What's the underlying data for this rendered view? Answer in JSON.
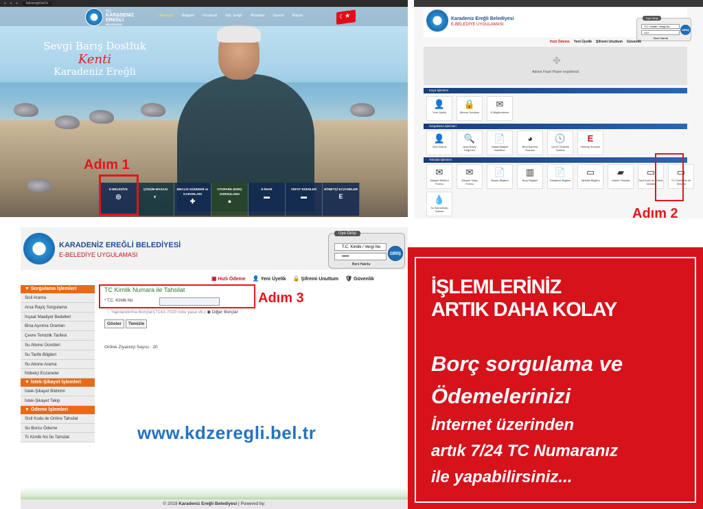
{
  "panel1": {
    "browser_url": "kdzeregli.bel.tr",
    "logo": {
      "line1": "T.C.",
      "line2": "KARADENİZ",
      "line3": "EREĞLİ",
      "line4": "BELEDİYESİ"
    },
    "menu": [
      "Anasayfa",
      "Belgeler",
      "Kurumsal",
      "Kdz. Ereğli",
      "Hizmetler",
      "Güncel",
      "İletişim"
    ],
    "slogan": {
      "line1": "Sevgi Barış Dostluk",
      "line2": "Kenti",
      "line3": "Karadeniz Ereğli"
    },
    "tiles": [
      {
        "label": "E-BELEDİYE",
        "icon": "◎"
      },
      {
        "label": "ÇÖZÜM MASASI",
        "icon": "◐"
      },
      {
        "label": "MECLİS GÜNDEMİ ve KARARLARI",
        "icon": "✚"
      },
      {
        "label": "OTOPARK BORÇ SORGULAMA",
        "icon": "●"
      },
      {
        "label": "E-İMAR",
        "icon": "▬"
      },
      {
        "label": "VEFAT EDENLER",
        "icon": "▬"
      },
      {
        "label": "NÖBETÇİ ECZANELER",
        "icon": "E"
      }
    ],
    "step_label": "Adım 1"
  },
  "panel2": {
    "org_name": "Karadeniz Ereğli Belediyesi",
    "app_name": "E-BELEDİYE UYGULAMASI",
    "login": {
      "tab": "Üye Girişi",
      "id_placeholder": "T.C. Kimlik / Vergi No",
      "password": "•••••",
      "remember": "Beni Hatırla",
      "submit": "GİRİŞ"
    },
    "links": [
      "Hızlı Ödeme",
      "Yeni Üyelik",
      "Şifremi Unuttum",
      "Güvenlik"
    ],
    "flash_text": "Adobe Flash Player engellendi",
    "sections": [
      {
        "title": "Kayıt İşlemleri",
        "items": [
          "Yeni Üyelik",
          "Şifremi Unuttum",
          "E-Bilgilendirme"
        ]
      },
      {
        "title": "Sorgulama İşlemleri",
        "items": [
          "Sicil Arama",
          "Arsa Rayiç Değerleri",
          "İnşaat Maliyet Bedelleri",
          "Bina Aşınma Oranları",
          "Çevre Temizlik Tarifesi",
          "Nöbetçi Eczane"
        ]
      },
      {
        "title": "Tahsilat İşlemleri",
        "items": [
          "Şikayet Bildirim Formu",
          "Şikayet Takip Formu",
          "Beyan Bilgileri",
          "Borç Bilgileri",
          "Tahakkuk Bilgileri",
          "Tahsilat Bilgileri",
          "Online Tahsilat",
          "Sicil Kodu ile Online Tahsilat",
          "TC Kimlik No ile Tahsilat",
          "Su Bornamatu Ödeme"
        ]
      }
    ],
    "step_label": "Adım 2"
  },
  "panel3": {
    "org_name": "KARADENİZ EREĞLİ BELEDİYESİ",
    "app_name": "E-BELEDİYE UYGULAMASI",
    "login": {
      "tab": "Üye Girişi",
      "id_placeholder": "T.C. Kimlik / Vergi No",
      "password": "•••••",
      "remember": "Beni Hatırla",
      "submit": "GİRİŞ"
    },
    "links": [
      "Hızlı Ödeme",
      "Yeni Üyelik",
      "Şifremi Unuttum",
      "Güvenlik"
    ],
    "sidebar": [
      {
        "group": "Sorgulama İşlemleri",
        "items": [
          "Sicil Arama",
          "Arsa Rayiç Sorgulama",
          "İnşaat Maaliyet Bedelleri",
          "Bina Aşınma Oranları",
          "Çevre Temizlik Tarifesi",
          "Su Abone Ücretleri",
          "Su Tarife Bilgileri",
          "Su Abone Arama",
          "Nöbetçi Eczaneler"
        ]
      },
      {
        "group": "İstek-Şikayet İşlemleri",
        "items": [
          "İstek-Şikayet Bildirimi",
          "İstek-Şikayet Takip"
        ]
      },
      {
        "group": "Ödeme İşlemleri",
        "items": [
          "Sicil Kodu ile Online Tahsilat",
          "Su Borcu Ödeme",
          "Tc Kimlik No İle Tahsilat"
        ]
      }
    ],
    "form": {
      "title": "TC Kimlik Numara ile Tahsilat",
      "field_label": "* T.C. Kimlik No",
      "field_value": "",
      "radio1": "Yapılandırma Borçları(7143-7020 nolu yasa vb.)",
      "radio2": "Diğer Borçlar",
      "btn_show": "Göster",
      "btn_clear": "Temizle"
    },
    "visitors": "Online Ziyaretçi Sayısı :  20",
    "website": "www.kdzeregli.bel.tr",
    "footer": {
      "copy": "© 2019",
      "org": "Karadeniz Ereğli Belediyesi",
      "powered": " | Powered by:"
    },
    "step_label": "Adım 3"
  },
  "banner": {
    "headline1": "İŞLEMLERİNİZ",
    "headline2": "ARTIK DAHA KOLAY",
    "line1": "Borç sorgulama ve",
    "line2": "Ödemelerinizi",
    "line3": "İnternet üzerinden",
    "line4": "artık  7/24 TC Numaranız",
    "line5": "ile yapabilirsiniz..."
  },
  "colors": {
    "brand_red": "#d6121b",
    "step_red": "#e3141c",
    "brand_blue": "#1a4f8f",
    "orange": "#e76a18"
  }
}
